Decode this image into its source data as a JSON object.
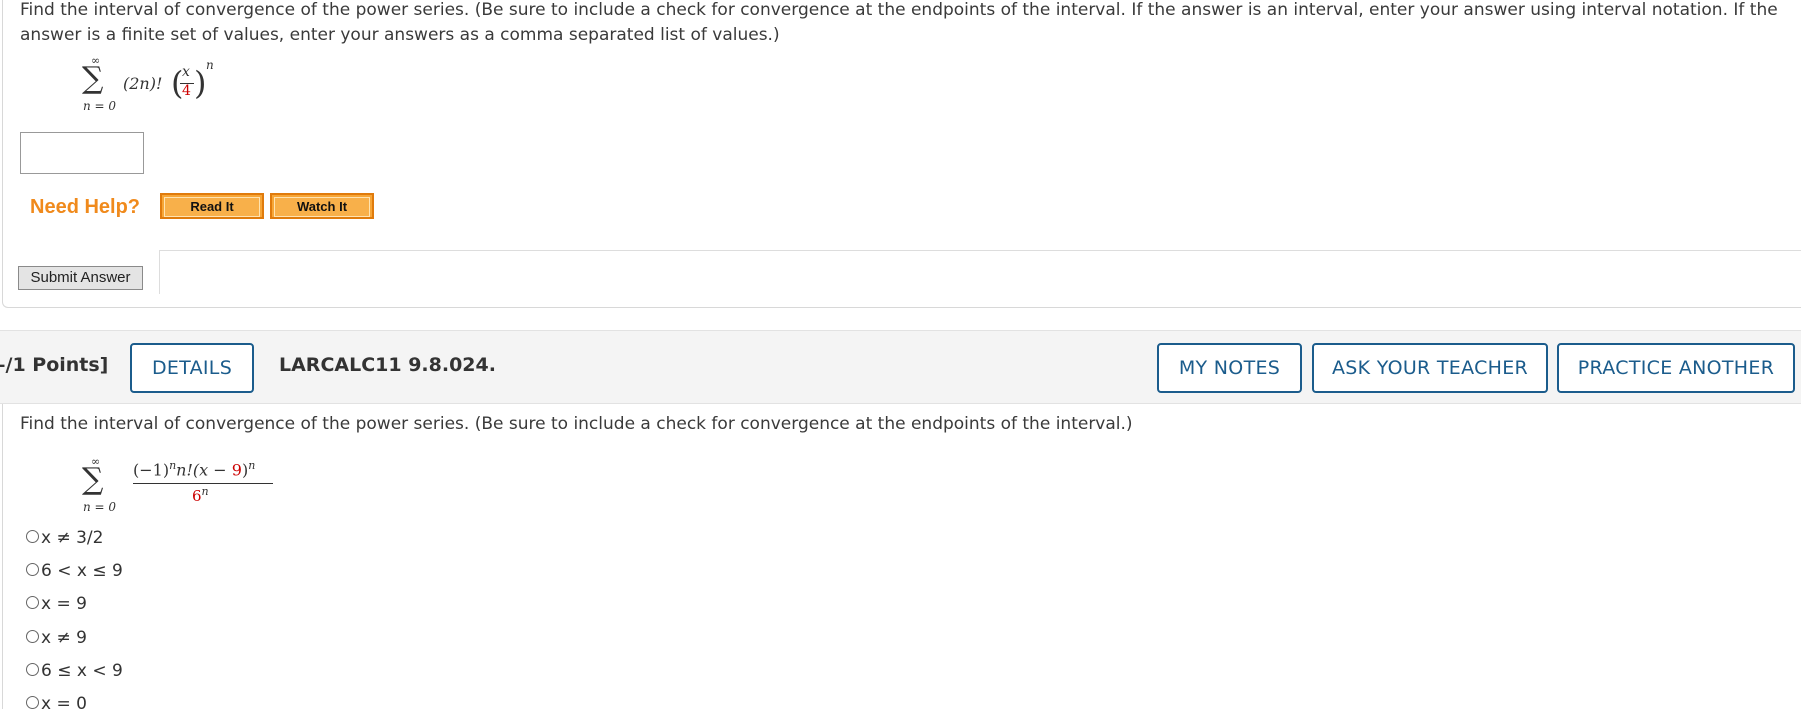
{
  "question1": {
    "prompt": "Find the interval of convergence of the power series. (Be sure to include a check for convergence at the endpoints of the interval. If the answer is an interval, enter your answer using interval notation. If the answer is a finite set of values, enter your answers as a comma separated list of values.)",
    "series": {
      "sigma": "∑",
      "upper": "∞",
      "lower": "n = 0",
      "coef": "(2n)!",
      "frac_num": "x",
      "frac_den": "4",
      "exponent": "n"
    },
    "answer_value": "",
    "need_help_label": "Need Help?",
    "read_it_label": "Read It",
    "watch_it_label": "Watch It",
    "submit_label": "Submit Answer"
  },
  "question2": {
    "points_label": "–/1 Points]",
    "details_label": "DETAILS",
    "problem_id": "LARCALC11 9.8.024.",
    "my_notes_label": "MY NOTES",
    "ask_teacher_label": "ASK YOUR TEACHER",
    "practice_another_label": "PRACTICE ANOTHER",
    "prompt": "Find the interval of convergence of the power series. (Be sure to include a check for convergence at the endpoints of the interval.)",
    "series": {
      "sigma": "∑",
      "upper": "∞",
      "lower": "n = 0",
      "numerator_pre": "(−1)",
      "numerator_exp1": "n",
      "numerator_mid": "n!(x − ",
      "numerator_red": "9",
      "numerator_post": ")",
      "numerator_exp2": "n",
      "denominator_base": "6",
      "denominator_exp": "n"
    },
    "options": [
      "x ≠ 3/2",
      "6 < x ≤ 9",
      "x = 9",
      "x ≠ 9",
      "6 ≤ x < 9",
      "x = 0"
    ]
  },
  "colors": {
    "accent_blue": "#1b5c8c",
    "help_orange": "#f08a1c",
    "red_values": "#cc0000"
  }
}
